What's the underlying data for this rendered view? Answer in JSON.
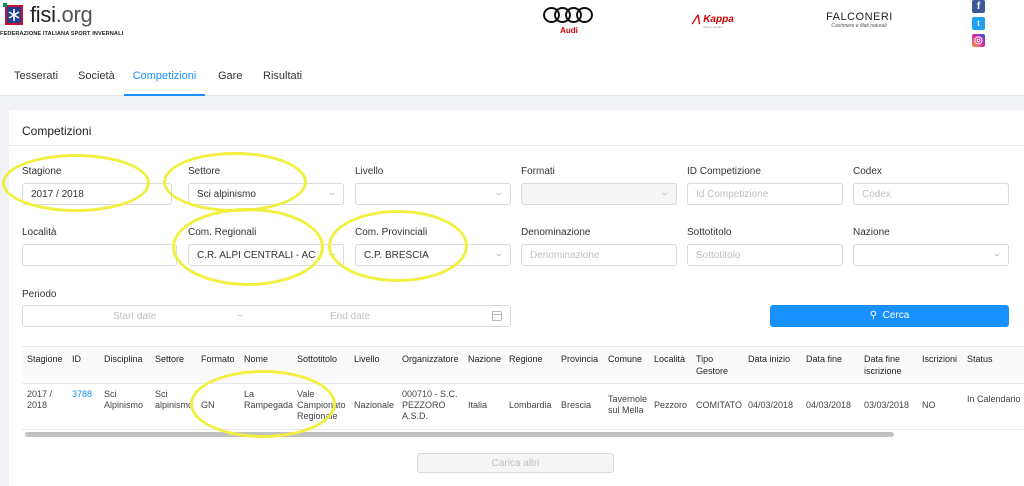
{
  "brand": {
    "name_main": "fisi",
    "name_tld": ".org",
    "subtitle": "FEDERAZIONE ITALIANA SPORT INVERNALI"
  },
  "sponsors": {
    "audi": "Audi",
    "kappa": "Kappa",
    "kappa_sub": "official supplier",
    "falconeri": "FALCONERI",
    "falconeri_sub": "Cashmere e filati naturali"
  },
  "social": {
    "facebook": "f",
    "twitter": "t",
    "instagram": "◎"
  },
  "nav": {
    "items": [
      "Tesserati",
      "Società",
      "Competizioni",
      "Gare",
      "Risultati"
    ],
    "active": "Competizioni"
  },
  "filters": {
    "title": "Competizioni",
    "stagione": {
      "label": "Stagione",
      "value": "2017 / 2018"
    },
    "settore": {
      "label": "Settore",
      "value": "Sci alpinismo"
    },
    "livello": {
      "label": "Livello",
      "value": ""
    },
    "formati": {
      "label": "Formati",
      "value": ""
    },
    "id_competizione": {
      "label": "ID Competizione",
      "placeholder": "Id Competizione"
    },
    "codex": {
      "label": "Codex",
      "placeholder": "Codex"
    },
    "localita": {
      "label": "Località",
      "value": ""
    },
    "com_regionali": {
      "label": "Com. Regionali",
      "value": "C.R. ALPI CENTRALI - AC"
    },
    "com_provinciali": {
      "label": "Com. Provinciali",
      "value": "C.P. BRESCIA"
    },
    "denominazione": {
      "label": "Denominazione",
      "placeholder": "Denominazione"
    },
    "sottotitolo": {
      "label": "Sottotitolo",
      "placeholder": "Sottotitolo"
    },
    "nazione": {
      "label": "Nazione",
      "value": ""
    },
    "periodo": {
      "label": "Periodo",
      "start_placeholder": "Start date",
      "separator": "~",
      "end_placeholder": "End date"
    },
    "search_button": "Cerca",
    "search_icon": "search-icon"
  },
  "table": {
    "columns": [
      "Stagione",
      "ID",
      "Disciplina",
      "Settore",
      "Formato",
      "Nome",
      "Sottotitolo",
      "Livello",
      "Organizzatore",
      "Nazione",
      "Regione",
      "Provincia",
      "Comune",
      "Località",
      "Tipo Gestore",
      "Data inizio",
      "Data fine",
      "Data fine iscrizione",
      "Iscrizioni",
      "Status"
    ],
    "rows": [
      [
        "2017 / 2018",
        "3788",
        "Sci Alpinismo",
        "Sci alpinismo",
        "GN",
        "La Rampegada",
        "Vale Campionato Regionale",
        "Nazionale",
        "000710 - S.C. PEZZORO A.S.D.",
        "Italia",
        "Lombardia",
        "Brescia",
        "Tavernole sul Mella",
        "Pezzoro",
        "COMITATO",
        "04/03/2018",
        "04/03/2018",
        "03/03/2018",
        "NO",
        "In Calendario"
      ]
    ]
  },
  "load_more_button": "Carica altri",
  "colors": {
    "accent": "#1890ff",
    "highlight": "#f0f040",
    "background": "#f0f2f5"
  }
}
